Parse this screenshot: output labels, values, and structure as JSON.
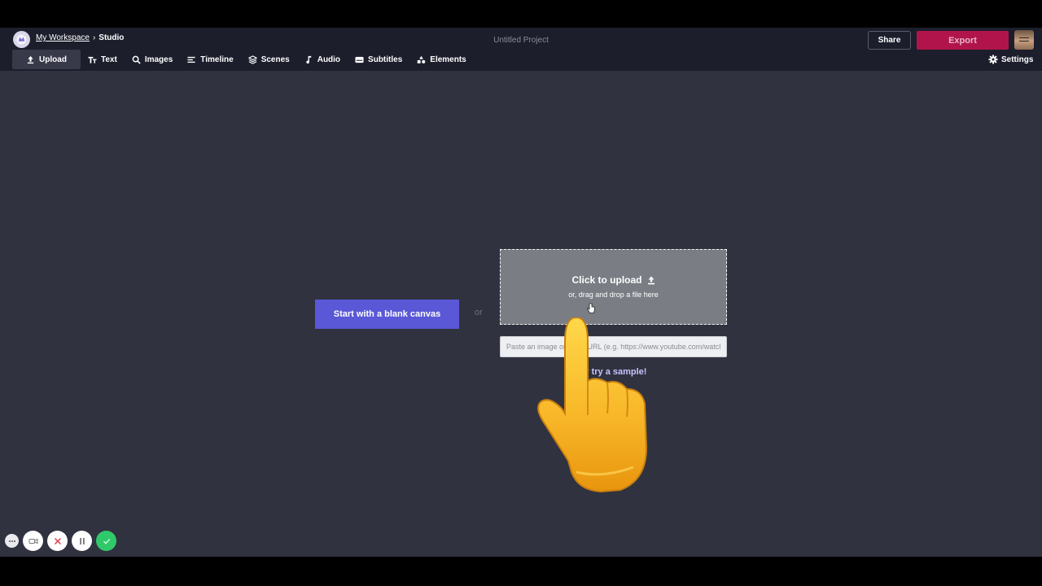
{
  "breadcrumb": {
    "workspace": "My Workspace",
    "separator": "›",
    "current": "Studio"
  },
  "project_title": "Untitled Project",
  "header": {
    "share_label": "Share",
    "export_label": "Export"
  },
  "toolbar": {
    "items": [
      {
        "label": "Upload",
        "icon": "upload-icon",
        "active": true
      },
      {
        "label": "Text",
        "icon": "text-icon"
      },
      {
        "label": "Images",
        "icon": "search-icon"
      },
      {
        "label": "Timeline",
        "icon": "timeline-icon"
      },
      {
        "label": "Scenes",
        "icon": "layers-icon"
      },
      {
        "label": "Audio",
        "icon": "music-note-icon"
      },
      {
        "label": "Subtitles",
        "icon": "subtitles-icon"
      },
      {
        "label": "Elements",
        "icon": "shapes-icon"
      }
    ],
    "settings_label": "Settings"
  },
  "main": {
    "blank_canvas_label": "Start with a blank canvas",
    "or_label": "or",
    "upload_title": "Click to upload",
    "upload_subtitle": "or, drag and drop a file here",
    "url_placeholder": "Paste an image or video URL (e.g. https://www.youtube.com/watch?v=...)",
    "sample_label": "or try a sample!"
  },
  "colors": {
    "background": "#30323f",
    "topbar": "#1c1e2c",
    "primary_button": "#5a58d6",
    "export": "#b0144a",
    "link": "#c6c4ff"
  },
  "recorder_controls": [
    "more-icon",
    "camera-icon",
    "close-icon",
    "pause-icon",
    "check-icon"
  ]
}
